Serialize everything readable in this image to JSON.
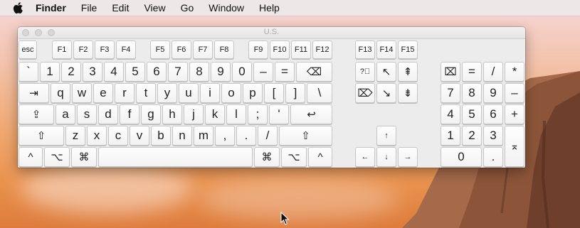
{
  "menubar": {
    "app_name": "Finder",
    "items": [
      "File",
      "Edit",
      "View",
      "Go",
      "Window",
      "Help"
    ]
  },
  "window": {
    "title": "U.S."
  },
  "keyboard": {
    "function_row": [
      "esc",
      "F1",
      "F2",
      "F3",
      "F4",
      "F5",
      "F6",
      "F7",
      "F8",
      "F9",
      "F10",
      "F11",
      "F12"
    ],
    "number_row": [
      "`",
      "1",
      "2",
      "3",
      "4",
      "5",
      "6",
      "7",
      "8",
      "9",
      "0",
      "–",
      "=",
      "⌫"
    ],
    "top_row": [
      "⇥",
      "q",
      "w",
      "e",
      "r",
      "t",
      "y",
      "u",
      "i",
      "o",
      "p",
      "[",
      "]",
      "\\"
    ],
    "home_row": [
      "⇪",
      "a",
      "s",
      "d",
      "f",
      "g",
      "h",
      "j",
      "k",
      "l",
      ";",
      "'",
      "↩"
    ],
    "bottom_row": [
      "⇧",
      "z",
      "x",
      "c",
      "v",
      "b",
      "n",
      "m",
      ",",
      ".",
      "/",
      "⇧"
    ],
    "modifier_row": [
      "^",
      "⌥",
      "⌘",
      "",
      "⌘",
      "⌥",
      "^"
    ],
    "extended_fkeys": [
      "F13",
      "F14",
      "F15"
    ],
    "nav_cluster": [
      "?⃝",
      "↖",
      "⇞",
      "⌦",
      "↘",
      "⇟"
    ],
    "arrows": [
      "↑",
      "←",
      "↓",
      "→"
    ],
    "numpad": [
      "⌧",
      "=",
      "/",
      "*",
      "7",
      "8",
      "9",
      "–",
      "4",
      "5",
      "6",
      "+",
      "1",
      "2",
      "3",
      "⌅",
      "0",
      "."
    ]
  }
}
